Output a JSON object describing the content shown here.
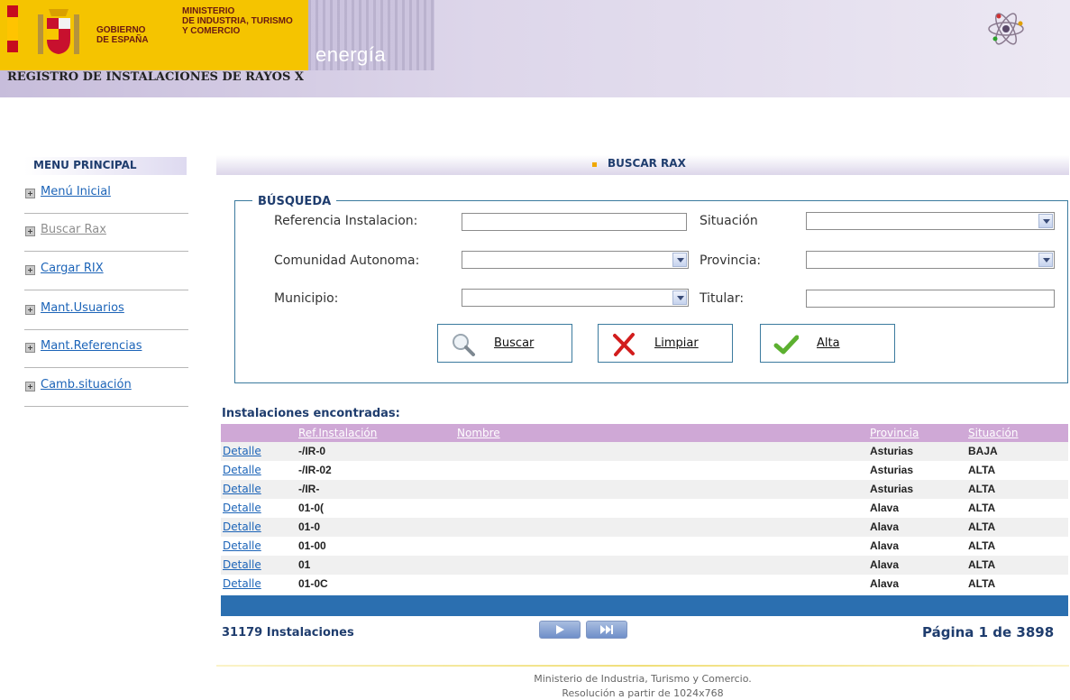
{
  "header": {
    "gov_line1": "GOBIERNO",
    "gov_line2": "DE ESPAÑA",
    "ministry_line1": "MINISTERIO",
    "ministry_line2": "DE INDUSTRIA, TURISMO",
    "ministry_line3": "Y COMERCIO",
    "brand": "energía",
    "app_title": "REGISTRO DE INSTALACIONES DE RAYOS X",
    "colors": {
      "banner": "#f5c400",
      "header_bg": "#d6cfe6"
    }
  },
  "sidebar": {
    "title": "MENU PRINCIPAL",
    "items": [
      {
        "label": "Menú Inicial",
        "active": true
      },
      {
        "label": "Buscar Rax",
        "active": false
      },
      {
        "label": "Cargar RIX",
        "active": true
      },
      {
        "label": "Mant.Usuarios",
        "active": true
      },
      {
        "label": "Mant.Referencias",
        "active": true
      },
      {
        "label": "Camb.situación",
        "active": true
      }
    ]
  },
  "main": {
    "title": "BUSCAR RAX",
    "search": {
      "legend": "BÚSQUEDA",
      "labels": {
        "referencia": "Referencia Instalacion:",
        "situacion": "Situación",
        "comunidad": "Comunidad Autonoma:",
        "provincia": "Provincia:",
        "municipio": "Municipio:",
        "titular": "Titular:"
      },
      "values": {
        "referencia": "",
        "situacion": "",
        "comunidad": "",
        "provincia": "",
        "municipio": "",
        "titular": ""
      },
      "buttons": {
        "buscar": "Buscar",
        "limpiar": "Limpiar",
        "alta": "Alta"
      }
    },
    "results": {
      "title": "Instalaciones encontradas:",
      "columns": [
        "Ref.Instalación",
        "Nombre",
        "Provincia",
        "Situación"
      ],
      "link_label": "Detalle",
      "rows": [
        {
          "ref": "-/IR-0",
          "nombre": "",
          "provincia": "Asturias",
          "situacion": "BAJA"
        },
        {
          "ref": "-/IR-02",
          "nombre": "",
          "provincia": "Asturias",
          "situacion": "ALTA"
        },
        {
          "ref": "-/IR-",
          "nombre": "",
          "provincia": "Asturias",
          "situacion": "ALTA"
        },
        {
          "ref": "01-0(",
          "nombre": "",
          "provincia": "Alava",
          "situacion": "ALTA"
        },
        {
          "ref": "01-0",
          "nombre": "",
          "provincia": "Alava",
          "situacion": "ALTA"
        },
        {
          "ref": "01-00",
          "nombre": "",
          "provincia": "Alava",
          "situacion": "ALTA"
        },
        {
          "ref": "01",
          "nombre": "",
          "provincia": "Alava",
          "situacion": "ALTA"
        },
        {
          "ref": "01-0C",
          "nombre": "",
          "provincia": "Alava",
          "situacion": "ALTA"
        }
      ],
      "count_label": "31179 Instalaciones",
      "page_label": "Página 1 de 3898",
      "pager_icons": [
        "play-next-icon",
        "skip-last-icon"
      ]
    }
  },
  "footer": {
    "line1": "Ministerio de Industria, Turismo y Comercio.",
    "line2": "Resolución a partir de 1024x768"
  }
}
